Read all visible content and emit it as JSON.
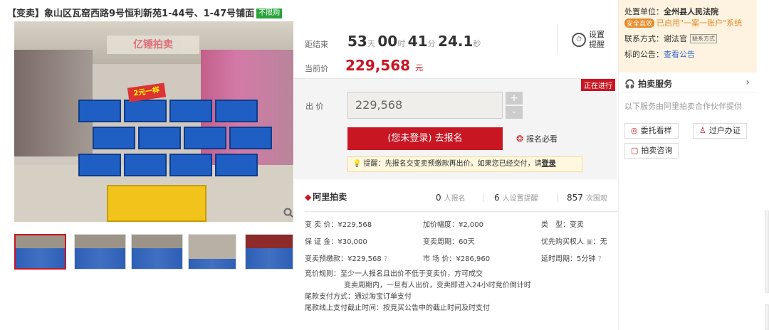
{
  "title": {
    "text": "【变卖】象山区瓦窑西路9号恒利新苑1-44号、1-47号铺面",
    "badge": "不限购"
  },
  "gallery": {
    "banner_text": "亿锤拍卖",
    "sign_text": "2元一样",
    "zoom_icon": "magnifier-icon",
    "thumbnail_count": 5
  },
  "countdown": {
    "label": "距结束",
    "days": "53",
    "days_unit": "天",
    "hours": "00",
    "hours_unit": "时",
    "minutes": "41",
    "minutes_unit": "分",
    "seconds": "24.1",
    "seconds_unit": "秒"
  },
  "reminder": {
    "icon": "clock-icon",
    "label": "设置提醒"
  },
  "current_price": {
    "label": "当前价",
    "value": "229,568",
    "unit": "元"
  },
  "bid": {
    "status": "正在进行",
    "label": "出 价",
    "input_value": "229,568",
    "plus": "+",
    "minus": "-",
    "signup_button": "(您未登录) 去报名",
    "must_read": "报名必看",
    "tip_text": "提醒：先报名交变卖预缴款再出价。如果您已经交付，请",
    "tip_link": "登录"
  },
  "stats": {
    "logo": "阿里拍卖",
    "signups": "0",
    "signups_label": "人报名",
    "reminders": "6",
    "reminders_label": "人设置提醒",
    "views": "857",
    "views_label": "次围观"
  },
  "info": {
    "sale_price": "变 卖 价：¥229,568",
    "increment": "加价幅度：¥2,000",
    "type": "类　型：变卖",
    "deposit": "保 证 金：¥30,000",
    "period": "变卖周期：60天",
    "priority": "优先购买权人",
    "priority_value": "：无",
    "prepay": "变卖预缴款：¥229,568",
    "market": "市 场 价：¥286,960",
    "delay": "延时周期：5分钟"
  },
  "rules": {
    "line1": "竞价规则：至少一人报名且出价不低于变卖价，方可成交",
    "line2": "变卖周期内，一旦有人出价，变卖即进入24小时竞价倒计时",
    "line3": "尾款支付方式：通过淘宝订单支付",
    "line4": "尾款线上支付截止时间：按竞买公告中的截止时间及时支付"
  },
  "court": {
    "unit_label": "处置单位：",
    "unit_name": "全州县人民法院",
    "shield_tag": "安全高效",
    "system_text": "已启用\"一案一账户\"系统",
    "contact_label": "联系方式：",
    "contact_name": "谢法官",
    "contact_tag": "联系方式",
    "notice_label": "标的公告：",
    "notice_link": "查看公告"
  },
  "services": {
    "title": "拍卖服务",
    "subtitle": "以下服务由阿里拍卖合作伙伴提供",
    "btn_view": "委托看样",
    "btn_transfer": "过户办证",
    "btn_consult": "拍卖咨询"
  },
  "colors": {
    "accent": "#c81623",
    "green": "#2aa33a",
    "orange": "#e58b2a"
  }
}
